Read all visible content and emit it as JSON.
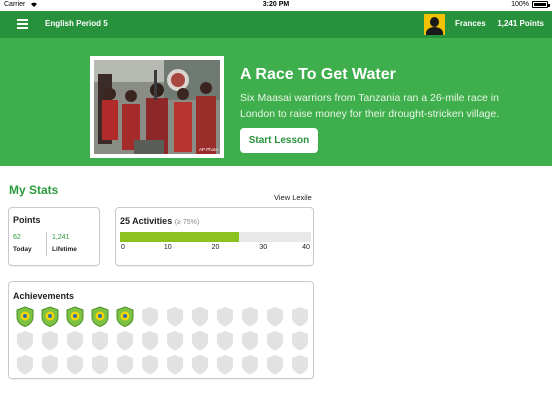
{
  "status_bar": {
    "carrier": "Carrier",
    "time": "3:20 PM",
    "battery": "100%"
  },
  "nav": {
    "menu_icon": "hamburger-menu-icon",
    "class_name": "English Period 5",
    "user_name": "Frances",
    "points": "1,241 Points"
  },
  "hero": {
    "title": "A Race To Get Water",
    "description": "Six Maasai warriors from Tanzania ran a 26-mile race in London to raise money for their drought-stricken village.",
    "button_label": "Start Lesson",
    "photo_credit": "AP Photo"
  },
  "stats": {
    "title": "My Stats",
    "view_lexile": "View Lexile",
    "points": {
      "title": "Points",
      "today_value": "62",
      "today_label": "Today",
      "lifetime_value": "1,241",
      "lifetime_label": "Lifetime"
    },
    "activities": {
      "title": "25 Activities",
      "percentile": "(≥ 75%)",
      "progress_value": 25,
      "progress_max": 40,
      "ticks": [
        "0",
        "10",
        "20",
        "30",
        "40"
      ]
    }
  },
  "achievements": {
    "title": "Achievements",
    "earned_count": 5,
    "total_count": 36,
    "columns": 12,
    "colors": {
      "earned_fill": "#7ec243",
      "earned_stroke": "#4e8f2a",
      "earned_inner": "#f5d600",
      "locked": "#e2e2e2"
    }
  },
  "colors": {
    "brand_green": "#27923b",
    "hero_green": "#3fae4c",
    "progress": "#8cc21f"
  }
}
